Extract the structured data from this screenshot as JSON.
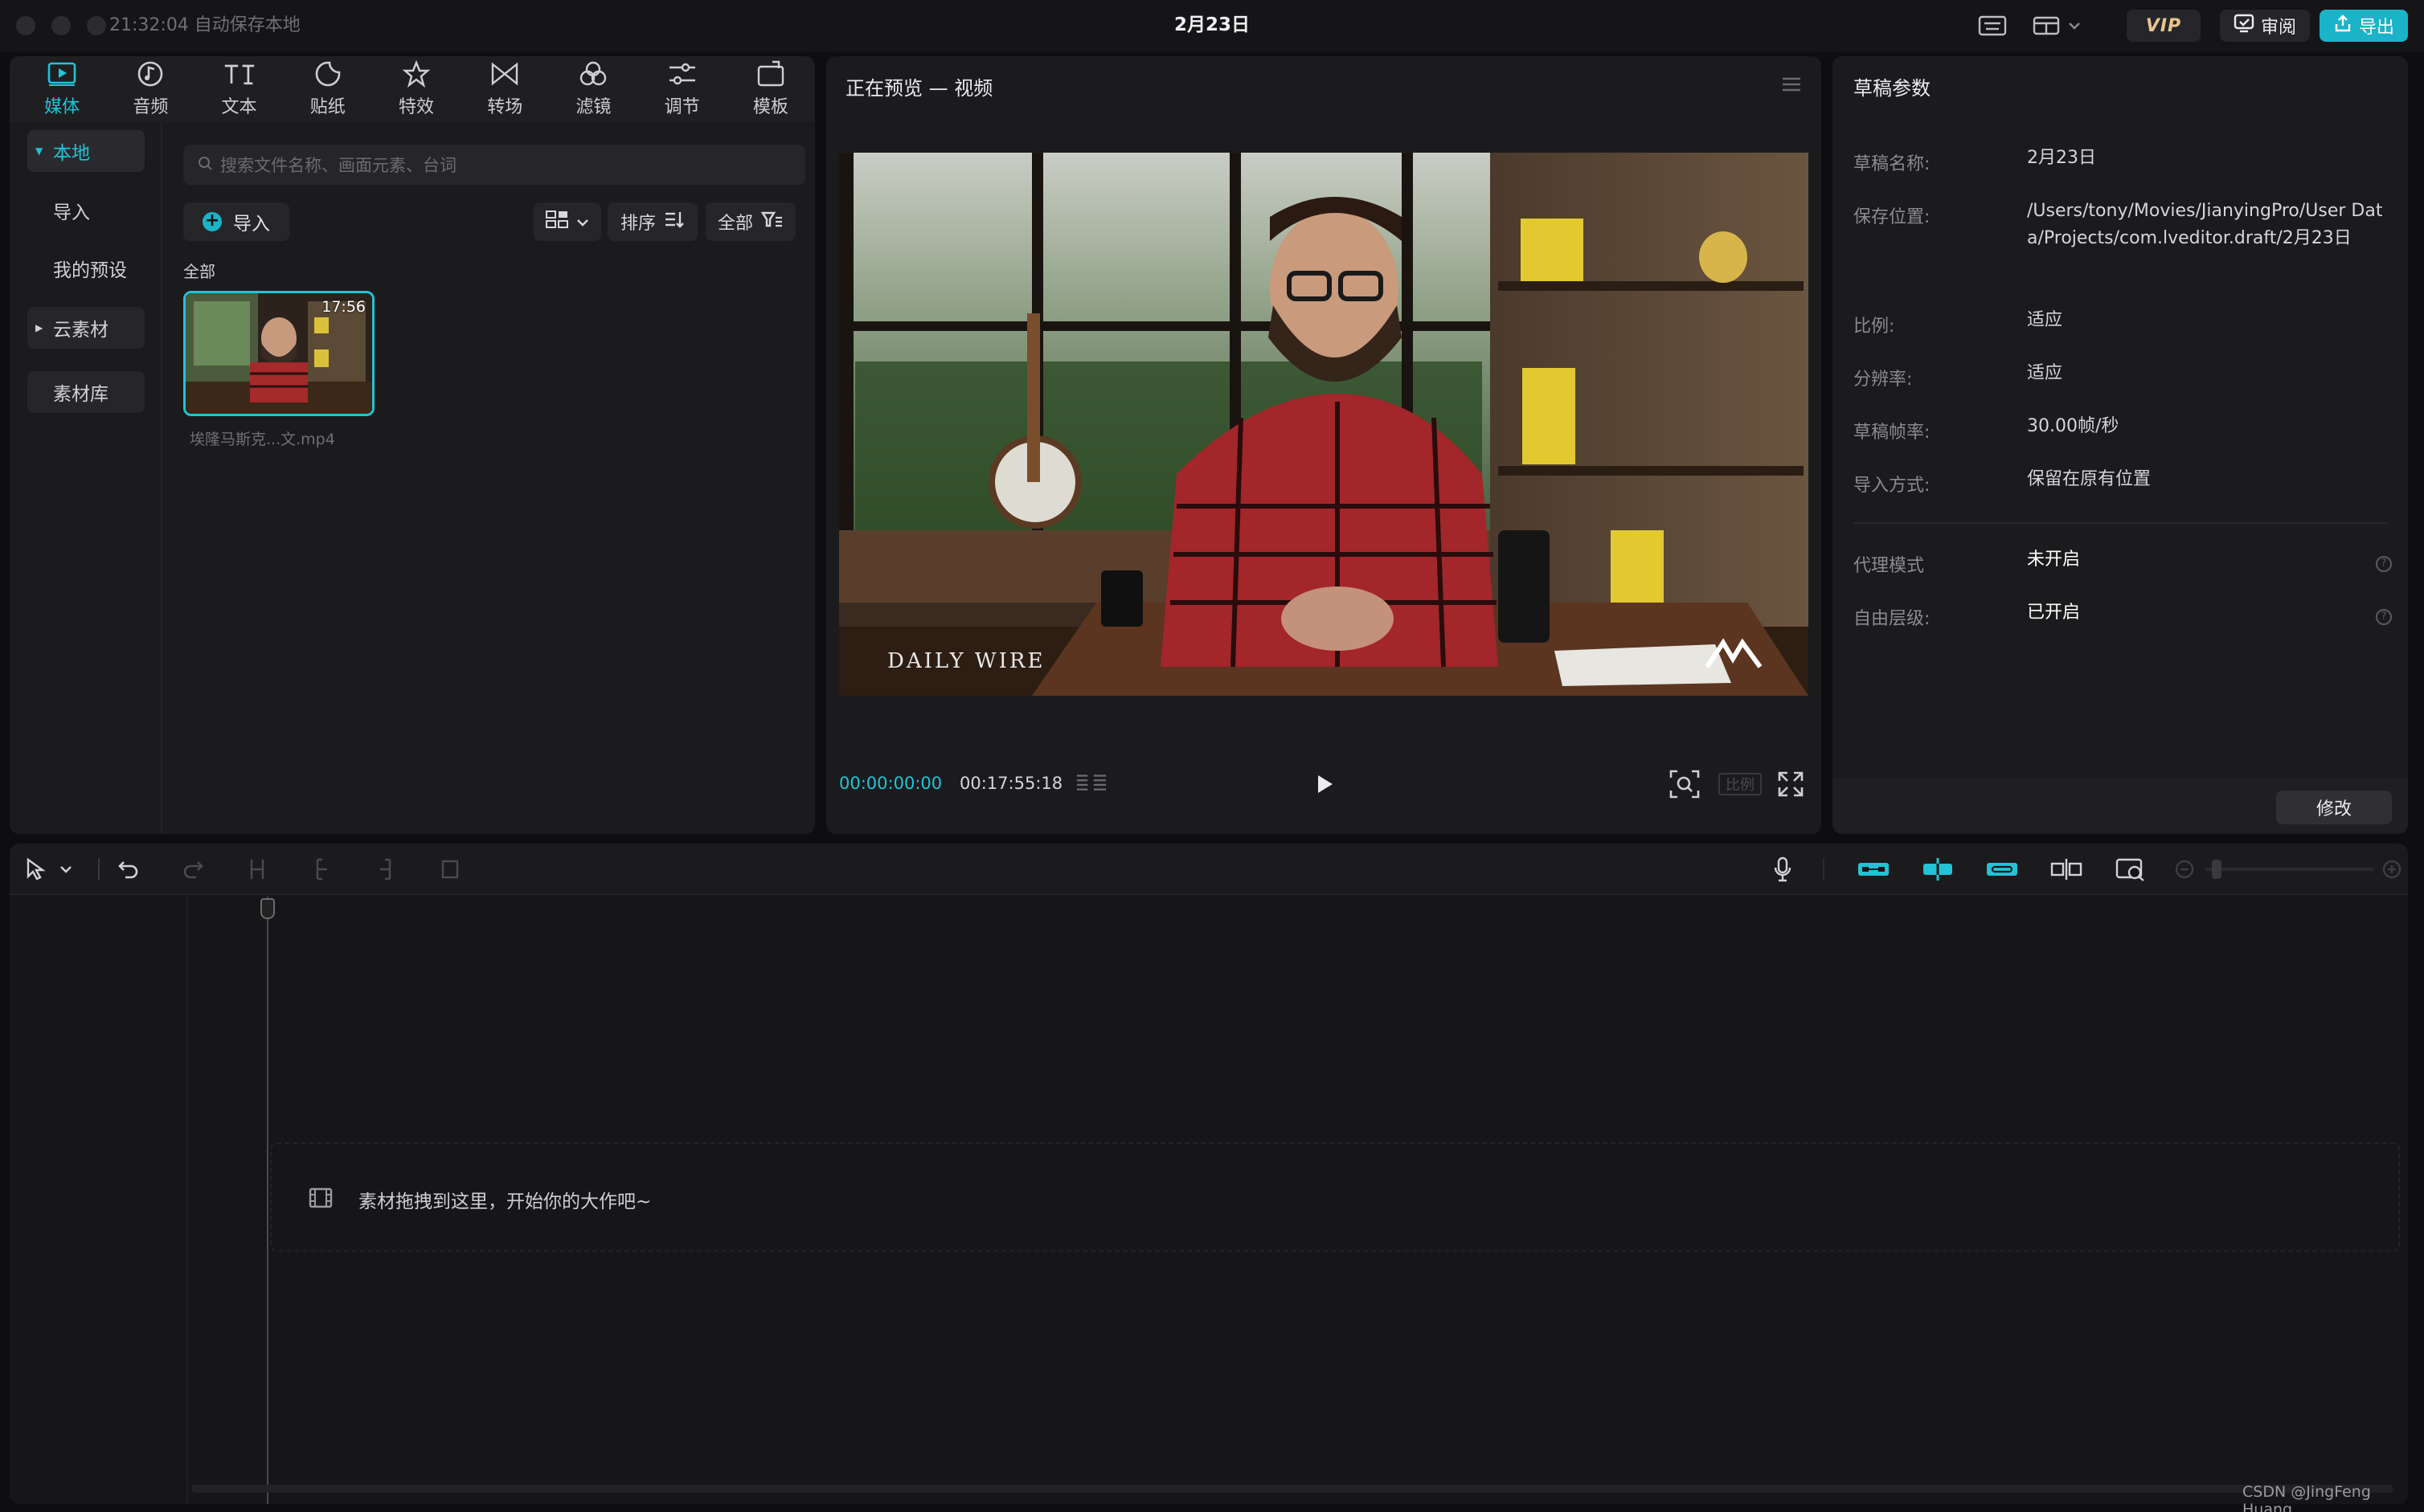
{
  "titlebar": {
    "autosave": "21:32:04 自动保存本地",
    "title": "2月23日",
    "vip_label": "VIP",
    "review_label": "审阅",
    "export_label": "导出"
  },
  "media": {
    "tabs": [
      {
        "label": "媒体",
        "icon": "media-play-icon"
      },
      {
        "label": "音频",
        "icon": "music-note-icon"
      },
      {
        "label": "文本",
        "icon": "text-icon"
      },
      {
        "label": "贴纸",
        "icon": "sticker-icon"
      },
      {
        "label": "特效",
        "icon": "effects-star-icon"
      },
      {
        "label": "转场",
        "icon": "transition-icon"
      },
      {
        "label": "滤镜",
        "icon": "filter-icon"
      },
      {
        "label": "调节",
        "icon": "adjust-sliders-icon"
      },
      {
        "label": "模板",
        "icon": "template-icon"
      }
    ],
    "nav": {
      "local": "本地",
      "import": "导入",
      "presets": "我的预设",
      "cloud": "云素材",
      "library": "素材库"
    },
    "search_placeholder": "搜索文件名称、画面元素、台词",
    "import_label": "导入",
    "sort_label": "排序",
    "filter_label": "全部",
    "section_label": "全部",
    "clip": {
      "duration": "17:56",
      "name": "埃隆马斯克...文.mp4"
    }
  },
  "preview": {
    "title": "正在预览 — 视频",
    "watermark": "DAILY WIRE",
    "timecode_current": "00:00:00:00",
    "timecode_total": "00:17:55:18",
    "ratio_label": "比例"
  },
  "props": {
    "title": "草稿参数",
    "rows": {
      "name_k": "草稿名称:",
      "name_v": "2月23日",
      "path_k": "保存位置:",
      "path_v": "/Users/tony/Movies/JianyingPro/User Data/Projects/com.lveditor.draft/2月23日",
      "ratio_k": "比例:",
      "ratio_v": "适应",
      "res_k": "分辨率:",
      "res_v": "适应",
      "fps_k": "草稿帧率:",
      "fps_v": "30.00帧/秒",
      "imp_k": "导入方式:",
      "imp_v": "保留在原有位置",
      "proxy_k": "代理模式",
      "proxy_v": "未开启",
      "layer_k": "自由层级:",
      "layer_v": "已开启"
    },
    "modify_label": "修改"
  },
  "timeline": {
    "drop_hint": "素材拖拽到这里，开始你的大作吧~"
  },
  "footer": {
    "watermark": "CSDN @JingFeng Huang"
  },
  "colors": {
    "accent": "#22c3d6",
    "export": "#1bb3c8",
    "panel": "#1b1b1d",
    "background": "#0e0e10"
  }
}
